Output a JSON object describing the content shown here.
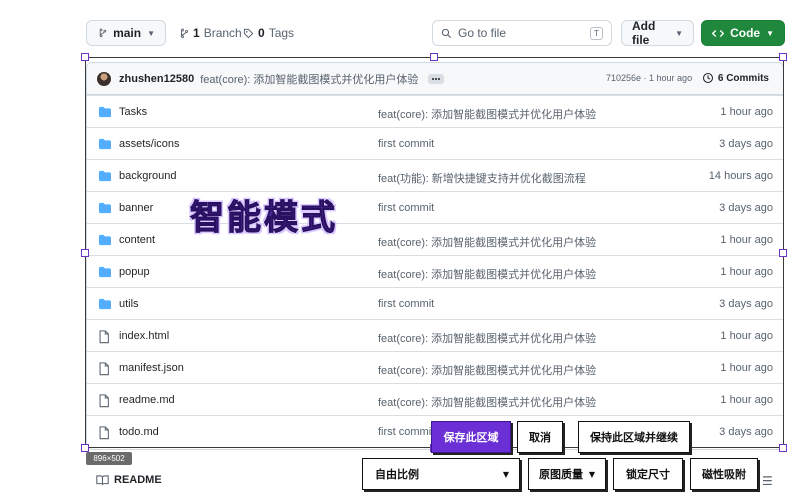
{
  "topbar": {
    "branch": "main",
    "branches_count": "1",
    "branches_label": "Branch",
    "tags_count": "0",
    "tags_label": "Tags",
    "search_placeholder": "Go to file",
    "search_shortcut": "T",
    "add_file_label": "Add file",
    "code_label": "Code"
  },
  "commit": {
    "author": "zhushen12580",
    "message": "feat(core): 添加智能截图模式并优化用户体验",
    "hash_time": "710256e · 1 hour ago",
    "commits_label": "6 Commits"
  },
  "files": [
    {
      "name": "Tasks",
      "type": "folder",
      "message": "feat(core): 添加智能截图模式并优化用户体验",
      "time": "1 hour ago"
    },
    {
      "name": "assets/icons",
      "type": "folder",
      "message": "first commit",
      "time": "3 days ago"
    },
    {
      "name": "background",
      "type": "folder",
      "message": "feat(功能): 新增快捷键支持并优化截图流程",
      "time": "14 hours ago"
    },
    {
      "name": "banner",
      "type": "folder",
      "message": "first commit",
      "time": "3 days ago"
    },
    {
      "name": "content",
      "type": "folder",
      "message": "feat(core): 添加智能截图模式并优化用户体验",
      "time": "1 hour ago"
    },
    {
      "name": "popup",
      "type": "folder",
      "message": "feat(core): 添加智能截图模式并优化用户体验",
      "time": "1 hour ago"
    },
    {
      "name": "utils",
      "type": "folder",
      "message": "first commit",
      "time": "3 days ago"
    },
    {
      "name": "index.html",
      "type": "file",
      "message": "feat(core): 添加智能截图模式并优化用户体验",
      "time": "1 hour ago"
    },
    {
      "name": "manifest.json",
      "type": "file",
      "message": "feat(core): 添加智能截图模式并优化用户体验",
      "time": "1 hour ago"
    },
    {
      "name": "readme.md",
      "type": "file",
      "message": "feat(core): 添加智能截图模式并优化用户体验",
      "time": "1 hour ago"
    },
    {
      "name": "todo.md",
      "type": "file",
      "message": "first commit",
      "time": "3 days ago"
    }
  ],
  "readme": {
    "label": "README",
    "menu": "☰"
  },
  "overlay": {
    "size_label": "896×502",
    "mode_banner": "智能模式",
    "save_label": "保存此区域",
    "cancel_label": "取消",
    "keep_label": "保持此区域并继续",
    "ratio_label": "自由比例",
    "quality_label": "原图质量",
    "lock_label": "锁定尺寸",
    "snap_label": "磁性吸附"
  },
  "colors": {
    "accent": "#6b2fd6",
    "code_green": "#1f883d",
    "folder_blue": "#54aeff"
  }
}
